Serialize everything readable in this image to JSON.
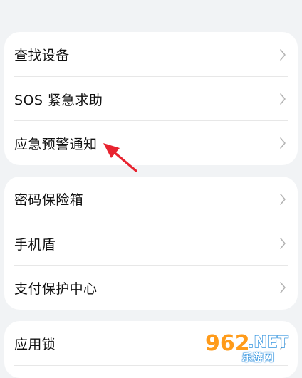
{
  "groups": [
    {
      "items": [
        {
          "label": "查找设备"
        },
        {
          "label": "SOS 紧急求助"
        },
        {
          "label": "应急预警通知"
        }
      ]
    },
    {
      "items": [
        {
          "label": "密码保险箱"
        },
        {
          "label": "手机盾"
        },
        {
          "label": "支付保护中心"
        }
      ]
    },
    {
      "items": [
        {
          "label": "应用锁"
        }
      ]
    }
  ],
  "watermark": {
    "logo_text": "962.NET",
    "subtitle": "乐游网"
  },
  "colors": {
    "background": "#f1f3f5",
    "card": "#ffffff",
    "text": "#111111",
    "chevron": "#b4b4b4",
    "annotation_arrow": "#e8232f"
  },
  "icons": {
    "chevron": "chevron-right-icon"
  }
}
